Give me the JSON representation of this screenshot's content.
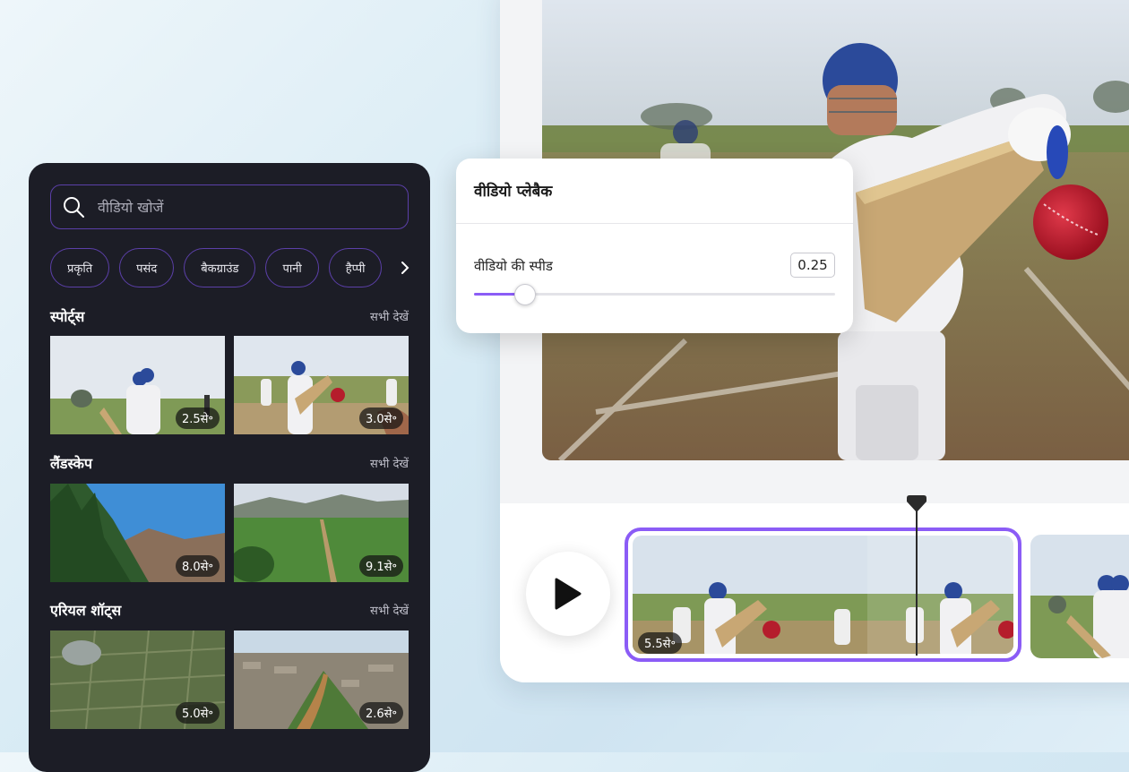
{
  "search": {
    "placeholder": "वीडियो खोजें"
  },
  "chips": [
    "प्रकृति",
    "पसंद",
    "बैकग्राउंड",
    "पानी",
    "हैप्पी"
  ],
  "sections": [
    {
      "title": "स्पोर्ट्स",
      "see_all": "सभी देखें",
      "thumbs": [
        {
          "duration": "2.5से॰"
        },
        {
          "duration": "3.0से॰"
        }
      ]
    },
    {
      "title": "लैंडस्केप",
      "see_all": "सभी देखें",
      "thumbs": [
        {
          "duration": "8.0से॰"
        },
        {
          "duration": "9.1से॰"
        }
      ]
    },
    {
      "title": "एरियल शॉट्स",
      "see_all": "सभी देखें",
      "thumbs": [
        {
          "duration": "5.0से॰"
        },
        {
          "duration": "2.6से॰"
        }
      ]
    }
  ],
  "playback": {
    "title": "वीडियो प्लेबैक",
    "speed_label": "वीडियो की स्पीड",
    "speed_value": "0.25",
    "speed_fraction": 0.14
  },
  "timeline": {
    "selected_clip_duration": "5.5से॰"
  },
  "colors": {
    "accent": "#8b5cf6",
    "panel": "#1c1d26",
    "chip_border": "#5b3fa8"
  }
}
